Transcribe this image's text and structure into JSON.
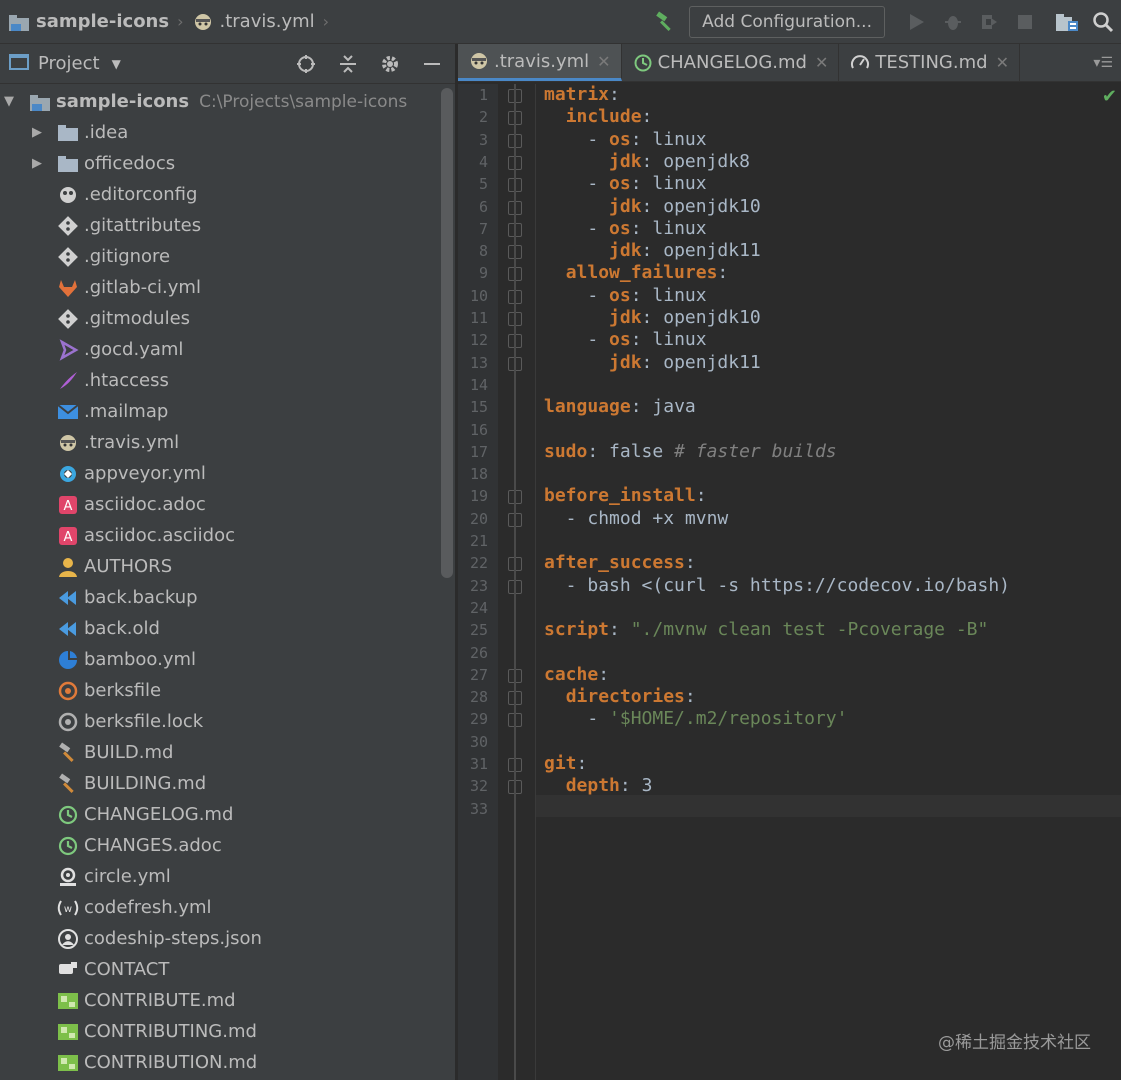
{
  "breadcrumb": {
    "project": "sample-icons",
    "file": ".travis.yml"
  },
  "toolbar": {
    "add_configuration": "Add Configuration..."
  },
  "project_panel": {
    "title": "Project",
    "root": {
      "name": "sample-icons",
      "path": "C:\\Projects\\sample-icons"
    },
    "items": [
      {
        "label": ".idea",
        "type": "folder",
        "icon": "folder-icon",
        "color": "#a9b7c6"
      },
      {
        "label": "officedocs",
        "type": "folder",
        "icon": "folder-icon",
        "color": "#a9b7c6"
      },
      {
        "label": ".editorconfig",
        "icon": "editorconfig-icon",
        "color": "#d0d0d0"
      },
      {
        "label": ".gitattributes",
        "icon": "git-icon",
        "color": "#d0d0d0"
      },
      {
        "label": ".gitignore",
        "icon": "git-icon",
        "color": "#d0d0d0"
      },
      {
        "label": ".gitlab-ci.yml",
        "icon": "gitlab-icon",
        "color": "#e2713a"
      },
      {
        "label": ".gitmodules",
        "icon": "git-icon",
        "color": "#d0d0d0"
      },
      {
        "label": ".gocd.yaml",
        "icon": "gocd-icon",
        "color": "#9b72cf"
      },
      {
        "label": ".htaccess",
        "icon": "feather-icon",
        "color": "#b05fd6"
      },
      {
        "label": ".mailmap",
        "icon": "mail-icon",
        "color": "#3d8fe0"
      },
      {
        "label": ".travis.yml",
        "icon": "travis-icon",
        "color": "#cfc6a6"
      },
      {
        "label": "appveyor.yml",
        "icon": "appveyor-icon",
        "color": "#3ba7e0"
      },
      {
        "label": "asciidoc.adoc",
        "icon": "asciidoc-icon",
        "color": "#e0456a"
      },
      {
        "label": "asciidoc.asciidoc",
        "icon": "asciidoc-icon",
        "color": "#e0456a"
      },
      {
        "label": "AUTHORS",
        "icon": "person-icon",
        "color": "#e8b54a"
      },
      {
        "label": "back.backup",
        "icon": "rewind-icon",
        "color": "#4a9be0"
      },
      {
        "label": "back.old",
        "icon": "rewind-icon",
        "color": "#4a9be0"
      },
      {
        "label": "bamboo.yml",
        "icon": "bamboo-icon",
        "color": "#2e7fd6"
      },
      {
        "label": "berksfile",
        "icon": "berkshelf-icon",
        "color": "#e07a3a"
      },
      {
        "label": "berksfile.lock",
        "icon": "berkshelf-icon",
        "color": "#b0b0b0"
      },
      {
        "label": "BUILD.md",
        "icon": "hammer-icon",
        "color": "#d08a3a"
      },
      {
        "label": "BUILDING.md",
        "icon": "hammer-icon",
        "color": "#d08a3a"
      },
      {
        "label": "CHANGELOG.md",
        "icon": "history-icon",
        "color": "#7ec97e"
      },
      {
        "label": "CHANGES.adoc",
        "icon": "history-icon",
        "color": "#7ec97e"
      },
      {
        "label": "circle.yml",
        "icon": "circleci-icon",
        "color": "#e0e0e0"
      },
      {
        "label": "codefresh.yml",
        "icon": "codefresh-icon",
        "color": "#e0e0e0"
      },
      {
        "label": "codeship-steps.json",
        "icon": "codeship-icon",
        "color": "#e0e0e0"
      },
      {
        "label": "CONTACT",
        "icon": "contact-icon",
        "color": "#e0e0e0"
      },
      {
        "label": "CONTRIBUTE.md",
        "icon": "contribute-icon",
        "color": "#7dbf4a"
      },
      {
        "label": "CONTRIBUTING.md",
        "icon": "contribute-icon",
        "color": "#7dbf4a"
      },
      {
        "label": "CONTRIBUTION.md",
        "icon": "contribute-icon",
        "color": "#7dbf4a"
      }
    ]
  },
  "editor": {
    "tabs": [
      {
        "label": ".travis.yml",
        "icon": "travis-icon",
        "active": true
      },
      {
        "label": "CHANGELOG.md",
        "icon": "history-icon",
        "active": false
      },
      {
        "label": "TESTING.md",
        "icon": "testing-icon",
        "active": false
      }
    ],
    "line_count": 33,
    "lines": [
      [
        [
          "k",
          "matrix"
        ],
        [
          "p",
          ":"
        ]
      ],
      [
        [
          "p",
          "  "
        ],
        [
          "k",
          "include"
        ],
        [
          "p",
          ":"
        ]
      ],
      [
        [
          "p",
          "    - "
        ],
        [
          "k",
          "os"
        ],
        [
          "p",
          ": "
        ],
        [
          "v",
          "linux"
        ]
      ],
      [
        [
          "p",
          "      "
        ],
        [
          "k",
          "jdk"
        ],
        [
          "p",
          ": "
        ],
        [
          "v",
          "openjdk8"
        ]
      ],
      [
        [
          "p",
          "    - "
        ],
        [
          "k",
          "os"
        ],
        [
          "p",
          ": "
        ],
        [
          "v",
          "linux"
        ]
      ],
      [
        [
          "p",
          "      "
        ],
        [
          "k",
          "jdk"
        ],
        [
          "p",
          ": "
        ],
        [
          "v",
          "openjdk10"
        ]
      ],
      [
        [
          "p",
          "    - "
        ],
        [
          "k",
          "os"
        ],
        [
          "p",
          ": "
        ],
        [
          "v",
          "linux"
        ]
      ],
      [
        [
          "p",
          "      "
        ],
        [
          "k",
          "jdk"
        ],
        [
          "p",
          ": "
        ],
        [
          "v",
          "openjdk11"
        ]
      ],
      [
        [
          "p",
          "  "
        ],
        [
          "k",
          "allow_failures"
        ],
        [
          "p",
          ":"
        ]
      ],
      [
        [
          "p",
          "    - "
        ],
        [
          "k",
          "os"
        ],
        [
          "p",
          ": "
        ],
        [
          "v",
          "linux"
        ]
      ],
      [
        [
          "p",
          "      "
        ],
        [
          "k",
          "jdk"
        ],
        [
          "p",
          ": "
        ],
        [
          "v",
          "openjdk10"
        ]
      ],
      [
        [
          "p",
          "    - "
        ],
        [
          "k",
          "os"
        ],
        [
          "p",
          ": "
        ],
        [
          "v",
          "linux"
        ]
      ],
      [
        [
          "p",
          "      "
        ],
        [
          "k",
          "jdk"
        ],
        [
          "p",
          ": "
        ],
        [
          "v",
          "openjdk11"
        ]
      ],
      [],
      [
        [
          "k",
          "language"
        ],
        [
          "p",
          ": "
        ],
        [
          "v",
          "java"
        ]
      ],
      [],
      [
        [
          "k",
          "sudo"
        ],
        [
          "p",
          ": "
        ],
        [
          "v",
          "false "
        ],
        [
          "c",
          "# faster builds"
        ]
      ],
      [],
      [
        [
          "k",
          "before_install"
        ],
        [
          "p",
          ":"
        ]
      ],
      [
        [
          "p",
          "  - "
        ],
        [
          "v",
          "chmod +x mvnw"
        ]
      ],
      [],
      [
        [
          "k",
          "after_success"
        ],
        [
          "p",
          ":"
        ]
      ],
      [
        [
          "p",
          "  - "
        ],
        [
          "v",
          "bash <(curl -s https://codecov.io/bash)"
        ]
      ],
      [],
      [
        [
          "k",
          "script"
        ],
        [
          "p",
          ": "
        ],
        [
          "s",
          "\"./mvnw clean test -Pcoverage -B\""
        ]
      ],
      [],
      [
        [
          "k",
          "cache"
        ],
        [
          "p",
          ":"
        ]
      ],
      [
        [
          "p",
          "  "
        ],
        [
          "k",
          "directories"
        ],
        [
          "p",
          ":"
        ]
      ],
      [
        [
          "p",
          "    - "
        ],
        [
          "s",
          "'$HOME/.m2/repository'"
        ]
      ],
      [],
      [
        [
          "k",
          "git"
        ],
        [
          "p",
          ":"
        ]
      ],
      [
        [
          "p",
          "  "
        ],
        [
          "k",
          "depth"
        ],
        [
          "p",
          ": "
        ],
        [
          "v",
          "3"
        ]
      ],
      []
    ]
  },
  "watermark": "@稀土掘金技术社区"
}
